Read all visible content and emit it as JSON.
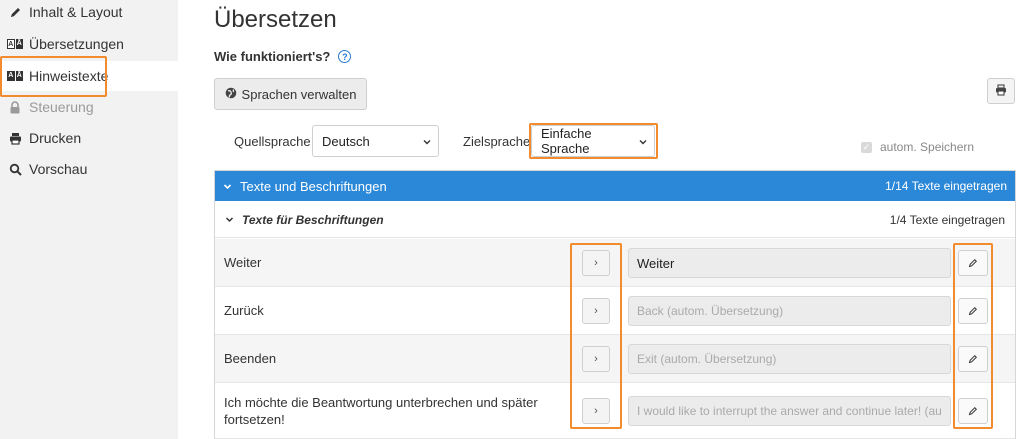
{
  "sidebar": {
    "items": [
      {
        "label": "Inhalt & Layout",
        "icon": "pencil-icon"
      },
      {
        "label": "Übersetzungen",
        "icon": "language-icon"
      },
      {
        "label": "Hinweistexte",
        "icon": "language-icon",
        "active": true
      },
      {
        "label": "Steuerung",
        "icon": "lock-icon",
        "disabled": true
      },
      {
        "label": "Drucken",
        "icon": "print-icon"
      },
      {
        "label": "Vorschau",
        "icon": "search-icon"
      }
    ]
  },
  "main": {
    "title": "Übersetzen",
    "howto": "Wie funktioniert's?",
    "manage_button": "Sprachen verwalten",
    "source_label": "Quellsprache",
    "source_value": "Deutsch",
    "target_label": "Zielsprache",
    "target_value": "Einfache Sprache",
    "autosave_label": "autom. Speichern"
  },
  "panel": {
    "title": "Texte und Beschriftungen",
    "count": "1/14 Texte eingetragen",
    "section": {
      "title": "Texte für Beschriftungen",
      "count": "1/4 Texte eingetragen"
    },
    "rows": [
      {
        "source": "Weiter",
        "target": "Weiter",
        "filled": true
      },
      {
        "source": "Zurück",
        "target": "Back (autom. Übersetzung)",
        "filled": false
      },
      {
        "source": "Beenden",
        "target": "Exit (autom. Übersetzung)",
        "filled": false
      },
      {
        "source": "Ich möchte die Beantwortung unterbrechen und später fortsetzen!",
        "target": "I would like to interrupt the answer and continue later! (au",
        "filled": false
      }
    ]
  },
  "colors": {
    "accent": "#2b88d8",
    "highlight": "#f28a2e",
    "help": "#2a7bd3"
  }
}
